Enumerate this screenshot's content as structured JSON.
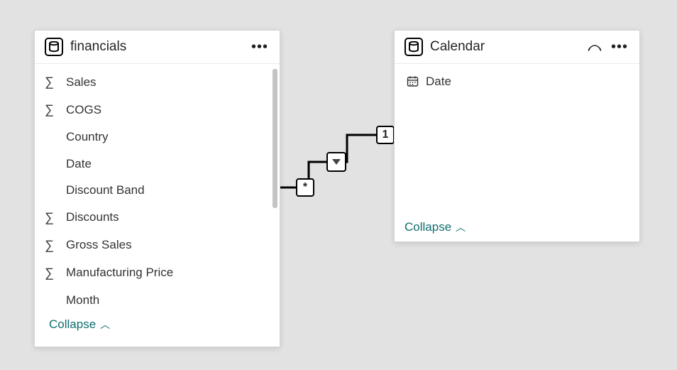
{
  "colors": {
    "collapse": "#116d6e"
  },
  "tables": {
    "financials": {
      "title": "financials",
      "collapse_label": "Collapse",
      "fields": [
        {
          "type": "measure",
          "label": "Sales"
        },
        {
          "type": "measure",
          "label": "COGS"
        },
        {
          "type": "column",
          "label": "Country"
        },
        {
          "type": "column",
          "label": "Date"
        },
        {
          "type": "column",
          "label": "Discount Band"
        },
        {
          "type": "measure",
          "label": "Discounts"
        },
        {
          "type": "measure",
          "label": "Gross Sales"
        },
        {
          "type": "measure",
          "label": "Manufacturing Price"
        },
        {
          "type": "column",
          "label": "Month"
        }
      ]
    },
    "calendar": {
      "title": "Calendar",
      "collapse_label": "Collapse",
      "fields": [
        {
          "type": "date",
          "label": "Date"
        }
      ]
    }
  },
  "relationship": {
    "from_cardinality": "*",
    "to_cardinality": "1",
    "direction": "single"
  }
}
